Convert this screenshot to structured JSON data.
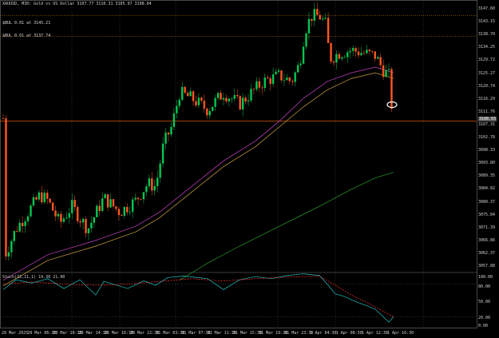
{
  "chart": {
    "title": "XAUUSD, M30:  Gold vs US Dollar  3107.77 3110.31 3105.97 3108.04",
    "symbol": "XAUUSD",
    "timeframe": "M30"
  },
  "levels": [
    {
      "label": "$BUL 0.01 at 3145.21",
      "price": 3145.21,
      "color": "#ff8c00"
    },
    {
      "label": "$BUL 0.01 at 3137.74",
      "price": 3137.74,
      "color": "#ff8c00"
    }
  ],
  "current_price": {
    "value": "3108.03",
    "price": 3108.03,
    "line_color": "#ff6a00"
  },
  "price_axis": [
    "3147.60",
    "3143.15",
    "3138.70",
    "3134.25",
    "3129.72",
    "3125.27",
    "3120.74",
    "3116.29",
    "3111.76",
    "3107.31",
    "3102.78",
    "3098.33",
    "3093.80",
    "3089.35",
    "3084.82",
    "3080.37",
    "3075.84",
    "3071.39",
    "3066.86",
    "3062.37",
    "3057.88"
  ],
  "stoch": {
    "label": "Stoch(22,11,1) 19.30 21.90",
    "axis": [
      "100.00",
      "80.00",
      "50.00",
      "20.00",
      "0.00"
    ]
  },
  "time_axis": [
    "28 Mar 2025",
    "28 Mar 06:30",
    "28 Mar 10:30",
    "28 Mar 14:30",
    "28 Mar 18:30",
    "28 Mar 22:30",
    "31 Mar 03:30",
    "31 Mar 07:30",
    "31 Mar 11:30",
    "31 Mar 15:30",
    "31 Mar 19:30",
    "31 Mar 23:30",
    "1 Apr 04:30",
    "1 Apr 08:30",
    "1 Apr 12:30",
    "1 Apr 16:30"
  ],
  "colors": {
    "bull": "#00c853",
    "bear": "#ff5722",
    "ma_magenta": "#c040c0",
    "ma_orange": "#c8a040",
    "ma_green": "#2e9e2e",
    "stoch_main": "#20c0c0",
    "stoch_signal": "#ff3030",
    "grid": "#5a5a5a"
  }
}
